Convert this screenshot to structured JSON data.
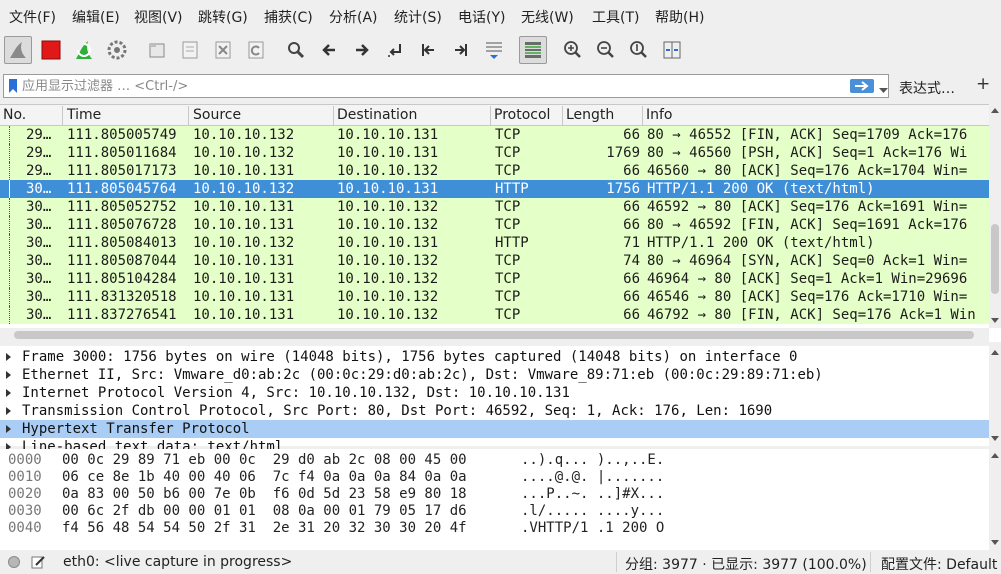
{
  "menu": [
    "文件(F)",
    "编辑(E)",
    "视图(V)",
    "跳转(G)",
    "捕获(C)",
    "分析(A)",
    "统计(S)",
    "电话(Y)",
    "无线(W)",
    "工具(T)",
    "帮助(H)"
  ],
  "toolbar": {
    "icons": [
      "shark-fin-start-icon",
      "stop-capture-icon",
      "restart-capture-icon",
      "capture-options-icon",
      "open-file-icon",
      "save-file-icon",
      "close-file-icon",
      "reload-file-icon",
      "find-packet-icon",
      "go-back-icon",
      "go-forward-icon",
      "go-to-packet-icon",
      "first-packet-icon",
      "last-packet-icon",
      "autoscroll-icon",
      "colorize-icon",
      "zoom-in-icon",
      "zoom-out-icon",
      "normal-size-icon",
      "resize-columns-icon"
    ]
  },
  "filter": {
    "placeholder": "应用显示过滤器 … <Ctrl-/>",
    "value": "",
    "expression_label": "表达式…",
    "add_label": "+"
  },
  "packet_list": {
    "columns": [
      "No.",
      "Time",
      "Source",
      "Destination",
      "Protocol",
      "Length",
      "Info"
    ],
    "rows": [
      {
        "no": "29…",
        "time": "111.805005749",
        "src": "10.10.10.132",
        "dst": "10.10.10.131",
        "proto": "TCP",
        "len": "66",
        "info": "80 → 46552 [FIN, ACK] Seq=1709 Ack=176"
      },
      {
        "no": "29…",
        "time": "111.805011684",
        "src": "10.10.10.132",
        "dst": "10.10.10.131",
        "proto": "TCP",
        "len": "1769",
        "info": "80 → 46560 [PSH, ACK] Seq=1 Ack=176 Wi"
      },
      {
        "no": "29…",
        "time": "111.805017173",
        "src": "10.10.10.131",
        "dst": "10.10.10.132",
        "proto": "TCP",
        "len": "66",
        "info": "46560 → 80 [ACK] Seq=176 Ack=1704 Win="
      },
      {
        "no": "30…",
        "time": "111.805045764",
        "src": "10.10.10.132",
        "dst": "10.10.10.131",
        "proto": "HTTP",
        "len": "1756",
        "info": "HTTP/1.1 200 OK  (text/html)"
      },
      {
        "no": "30…",
        "time": "111.805052752",
        "src": "10.10.10.131",
        "dst": "10.10.10.132",
        "proto": "TCP",
        "len": "66",
        "info": "46592 → 80 [ACK] Seq=176 Ack=1691 Win="
      },
      {
        "no": "30…",
        "time": "111.805076728",
        "src": "10.10.10.131",
        "dst": "10.10.10.132",
        "proto": "TCP",
        "len": "66",
        "info": "80 → 46592 [FIN, ACK] Seq=1691 Ack=176"
      },
      {
        "no": "30…",
        "time": "111.805084013",
        "src": "10.10.10.132",
        "dst": "10.10.10.131",
        "proto": "HTTP",
        "len": "71",
        "info": "HTTP/1.1 200 OK  (text/html)"
      },
      {
        "no": "30…",
        "time": "111.805087044",
        "src": "10.10.10.131",
        "dst": "10.10.10.132",
        "proto": "TCP",
        "len": "74",
        "info": "80 → 46964 [SYN, ACK] Seq=0 Ack=1 Win="
      },
      {
        "no": "30…",
        "time": "111.805104284",
        "src": "10.10.10.131",
        "dst": "10.10.10.132",
        "proto": "TCP",
        "len": "66",
        "info": "46964 → 80 [ACK] Seq=1 Ack=1 Win=29696"
      },
      {
        "no": "30…",
        "time": "111.831320518",
        "src": "10.10.10.131",
        "dst": "10.10.10.132",
        "proto": "TCP",
        "len": "66",
        "info": "46546 → 80 [ACK] Seq=176 Ack=1710 Win="
      },
      {
        "no": "30…",
        "time": "111.837276541",
        "src": "10.10.10.131",
        "dst": "10.10.10.132",
        "proto": "TCP",
        "len": "66",
        "info": "46792 → 80 [FIN, ACK] Seq=176 Ack=1 Win"
      }
    ],
    "selected_index": 3
  },
  "detail": {
    "items": [
      "Frame 3000: 1756 bytes on wire (14048 bits), 1756 bytes captured (14048 bits) on interface 0",
      "Ethernet II, Src: Vmware_d0:ab:2c (00:0c:29:d0:ab:2c), Dst: Vmware_89:71:eb (00:0c:29:89:71:eb)",
      "Internet Protocol Version 4, Src: 10.10.10.132, Dst: 10.10.10.131",
      "Transmission Control Protocol, Src Port: 80, Dst Port: 46592, Seq: 1, Ack: 176, Len: 1690",
      "Hypertext Transfer Protocol",
      "Line-based text data: text/html"
    ],
    "selected_index": 4
  },
  "hex": {
    "rows": [
      {
        "offset": "0000",
        "bytes": "00 0c 29 89 71 eb 00 0c  29 d0 ab 2c 08 00 45 00",
        "ascii": "..).q... )..,..E."
      },
      {
        "offset": "0010",
        "bytes": "06 ce 8e 1b 40 00 40 06  7c f4 0a 0a 0a 84 0a 0a",
        "ascii": "....@.@. |......."
      },
      {
        "offset": "0020",
        "bytes": "0a 83 00 50 b6 00 7e 0b  f6 0d 5d 23 58 e9 80 18",
        "ascii": "...P..~. ..]#X..."
      },
      {
        "offset": "0030",
        "bytes": "00 6c 2f db 00 00 01 01  08 0a 00 01 79 05 17 d6",
        "ascii": ".l/..... ....y..."
      },
      {
        "offset": "0040",
        "bytes": "f4 56 48 54 54 50 2f 31  2e 31 20 32 30 30 20 4f",
        "ascii": ".VHTTP/1 .1 200 O"
      }
    ]
  },
  "status": {
    "interface": "eth0: <live capture in progress>",
    "count": "分组: 3977 · 已显示: 3977 (100.0%)",
    "profile": "配置文件: Default"
  },
  "colors": {
    "row_green": "#e4ffc7",
    "row_selected": "#3f8fd8",
    "detail_selected": "#a9cdf4"
  }
}
